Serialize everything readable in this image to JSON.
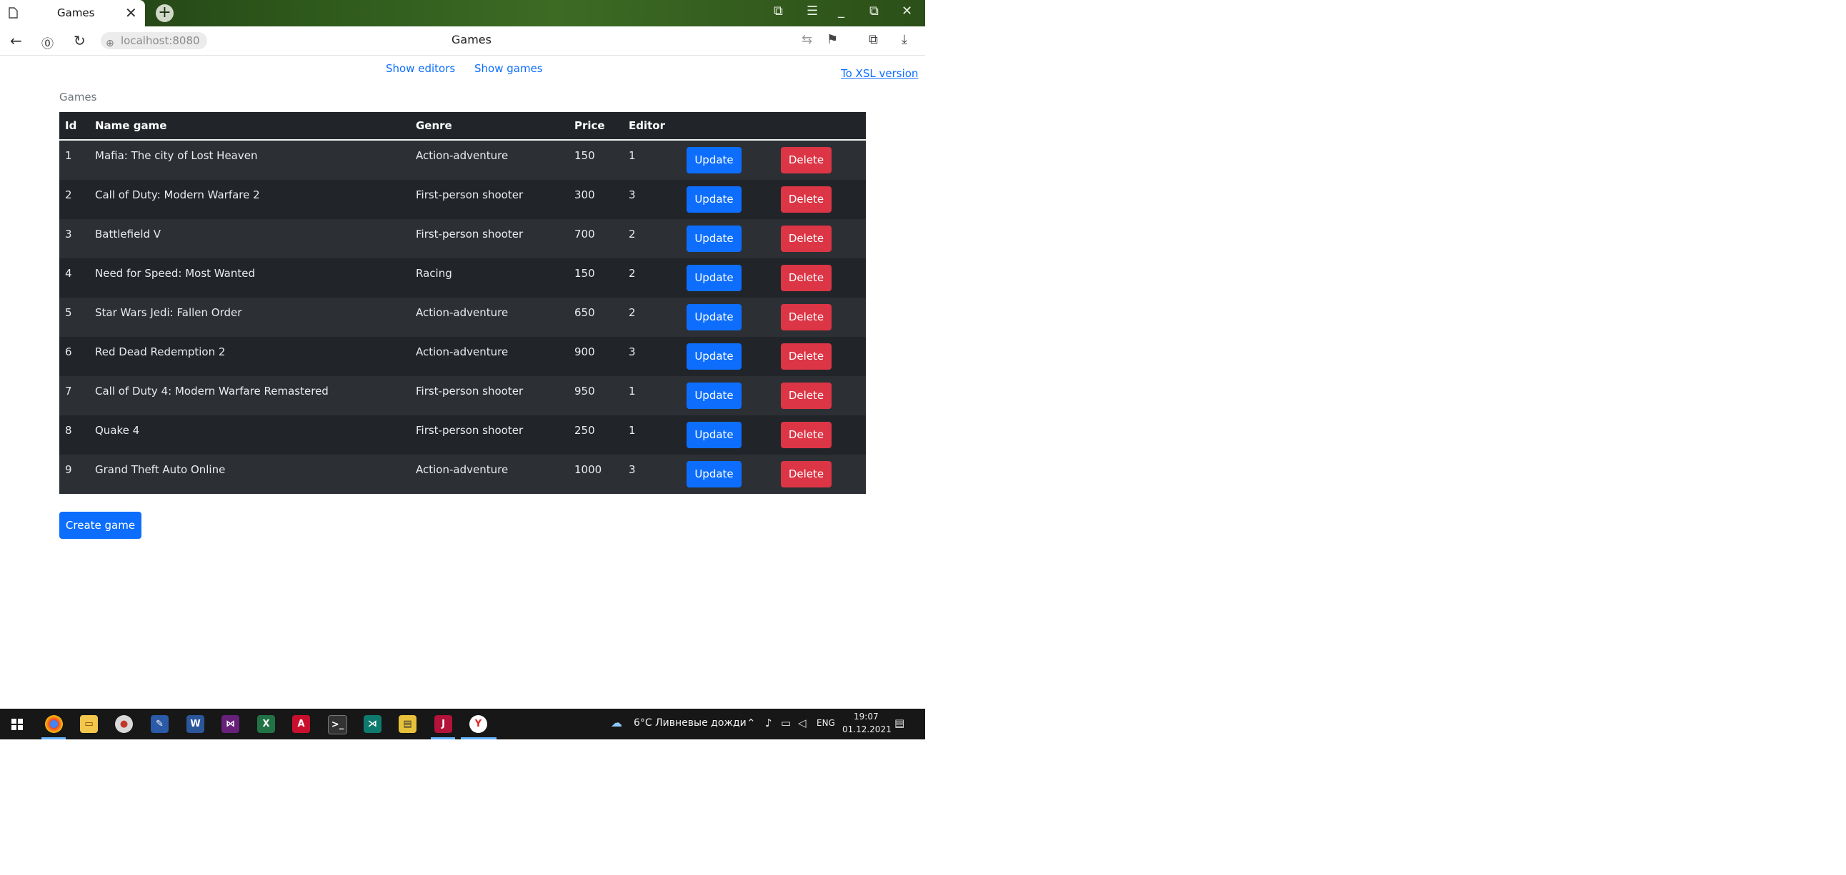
{
  "browser": {
    "tab_title": "Games",
    "tab_close": "✕",
    "new_tab": "+",
    "url": "localhost:8080",
    "page_title": "Games"
  },
  "nav": {
    "show_editors": "Show editors",
    "show_games": "Show games",
    "xsl_link": "To XSL version"
  },
  "caption": "Games",
  "table": {
    "headers": [
      "Id",
      "Name game",
      "Genre",
      "Price",
      "Editor"
    ],
    "rows": [
      {
        "id": "1",
        "name": "Mafia: The city of Lost Heaven",
        "genre": "Action-adventure",
        "price": "150",
        "editor": "1"
      },
      {
        "id": "2",
        "name": "Call of Duty: Modern Warfare 2",
        "genre": "First-person shooter",
        "price": "300",
        "editor": "3"
      },
      {
        "id": "3",
        "name": "Battlefield V",
        "genre": "First-person shooter",
        "price": "700",
        "editor": "2"
      },
      {
        "id": "4",
        "name": "Need for Speed: Most Wanted",
        "genre": "Racing",
        "price": "150",
        "editor": "2"
      },
      {
        "id": "5",
        "name": "Star Wars Jedi: Fallen Order",
        "genre": "Action-adventure",
        "price": "650",
        "editor": "2"
      },
      {
        "id": "6",
        "name": "Red Dead Redemption 2",
        "genre": "Action-adventure",
        "price": "900",
        "editor": "3"
      },
      {
        "id": "7",
        "name": "Call of Duty 4: Modern Warfare Remastered",
        "genre": "First-person shooter",
        "price": "950",
        "editor": "1"
      },
      {
        "id": "8",
        "name": "Quake 4",
        "genre": "First-person shooter",
        "price": "250",
        "editor": "1"
      },
      {
        "id": "9",
        "name": "Grand Theft Auto Online",
        "genre": "Action-adventure",
        "price": "1000",
        "editor": "3"
      }
    ],
    "update_label": "Update",
    "delete_label": "Delete"
  },
  "create_label": "Create game",
  "taskbar": {
    "weather": "6°C  Ливневые дожди",
    "language": "ENG",
    "time": "19:07",
    "date": "01.12.2021",
    "apps": [
      "windows-start",
      "chrome",
      "file-explorer",
      "paint",
      "pen-app",
      "word",
      "visual-studio",
      "excel",
      "acrobat",
      "terminal",
      "vscode",
      "sticky-app",
      "jetbrains",
      "yandex-browser"
    ]
  },
  "colors": {
    "primary": "#0d6efd",
    "danger": "#dc3545",
    "table_dark": "#212529",
    "table_stripe": "#2c3034",
    "taskbar": "#171717"
  }
}
